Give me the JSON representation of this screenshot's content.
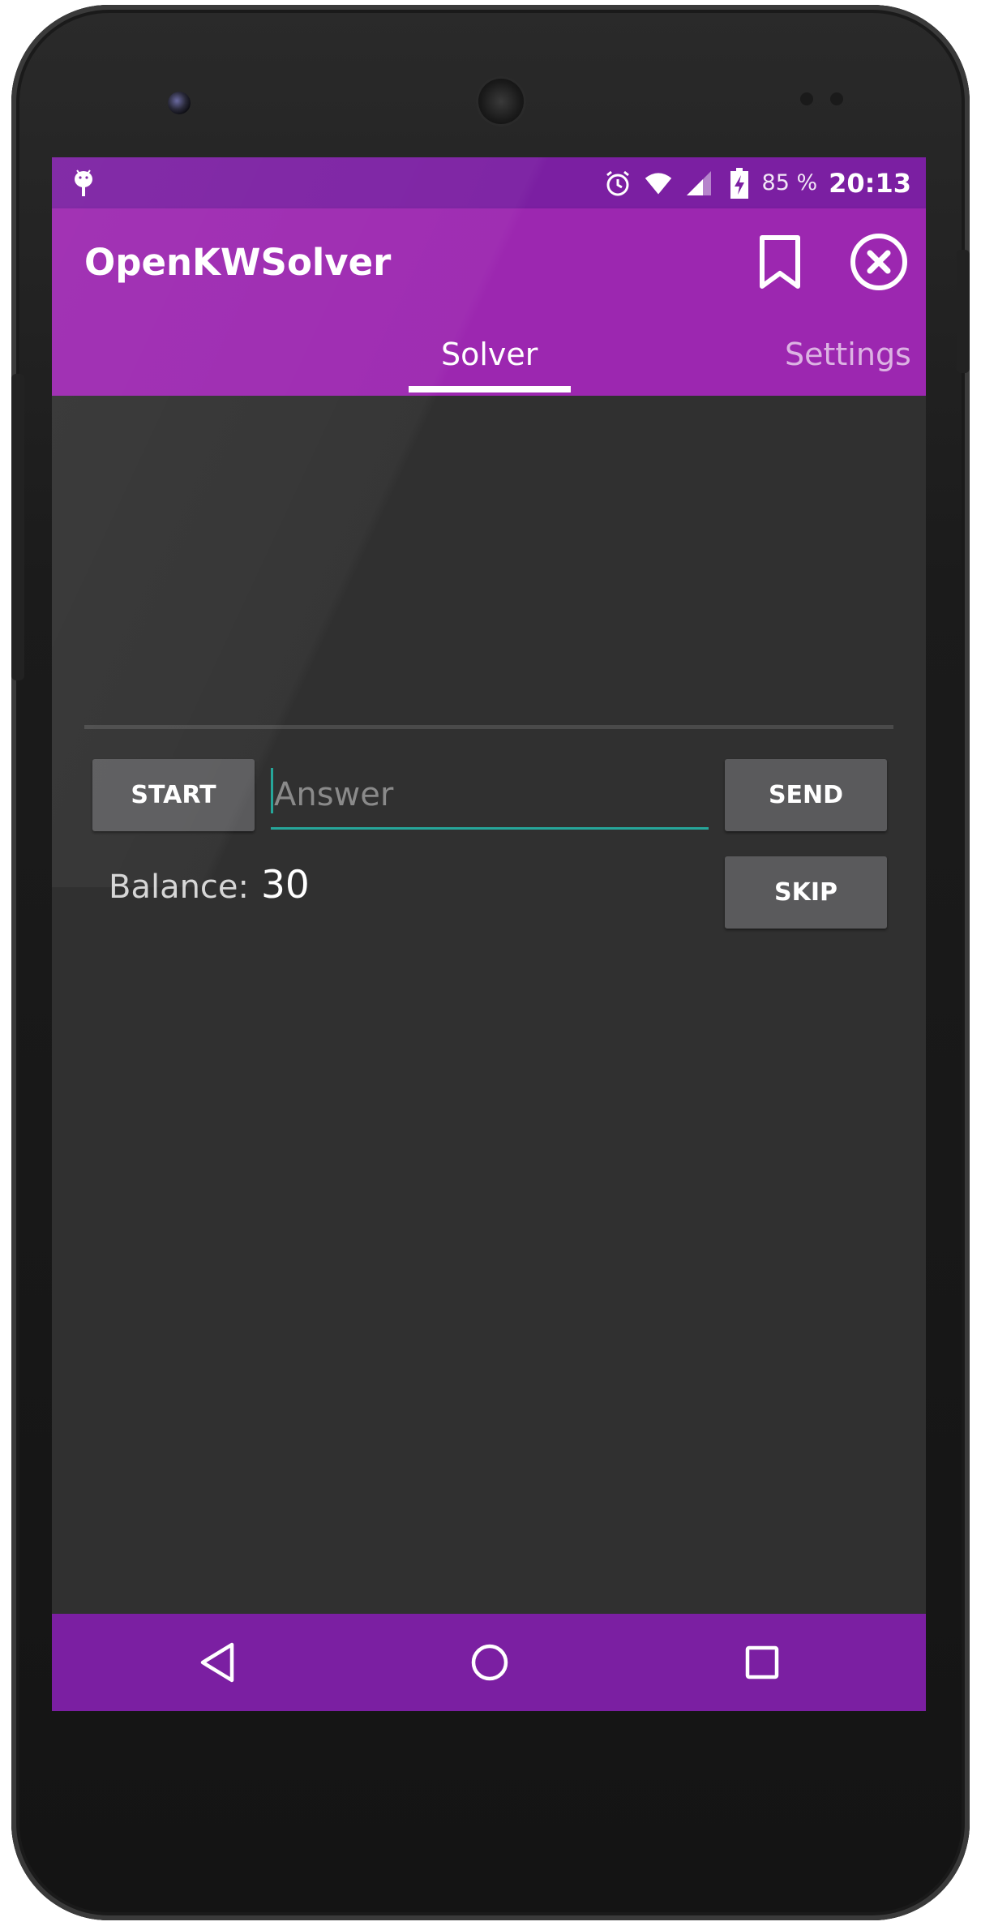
{
  "status_bar": {
    "battery_percent": "85 %",
    "time": "20:13",
    "icons": [
      "android-debug-icon",
      "alarm-icon",
      "wifi-icon",
      "signal-icon",
      "battery-charging-icon"
    ]
  },
  "app_bar": {
    "title": "OpenKWSolver",
    "actions": [
      "bookmark-icon",
      "close-circle-icon"
    ]
  },
  "tabs": [
    {
      "label": "Solver",
      "selected": true
    },
    {
      "label": "Settings",
      "selected": false
    }
  ],
  "solver": {
    "start_label": "START",
    "answer_placeholder": "Answer",
    "answer_value": "",
    "send_label": "SEND",
    "skip_label": "SKIP",
    "balance_label": "Balance:",
    "balance_value": "30"
  },
  "nav_bar": {
    "icons": [
      "back-icon",
      "home-icon",
      "recents-icon"
    ]
  },
  "colors": {
    "primary": "#9c27b0",
    "primary_dark": "#7b1fa2",
    "accent": "#26a69a",
    "background": "#303030",
    "button": "#5a5a5c"
  }
}
